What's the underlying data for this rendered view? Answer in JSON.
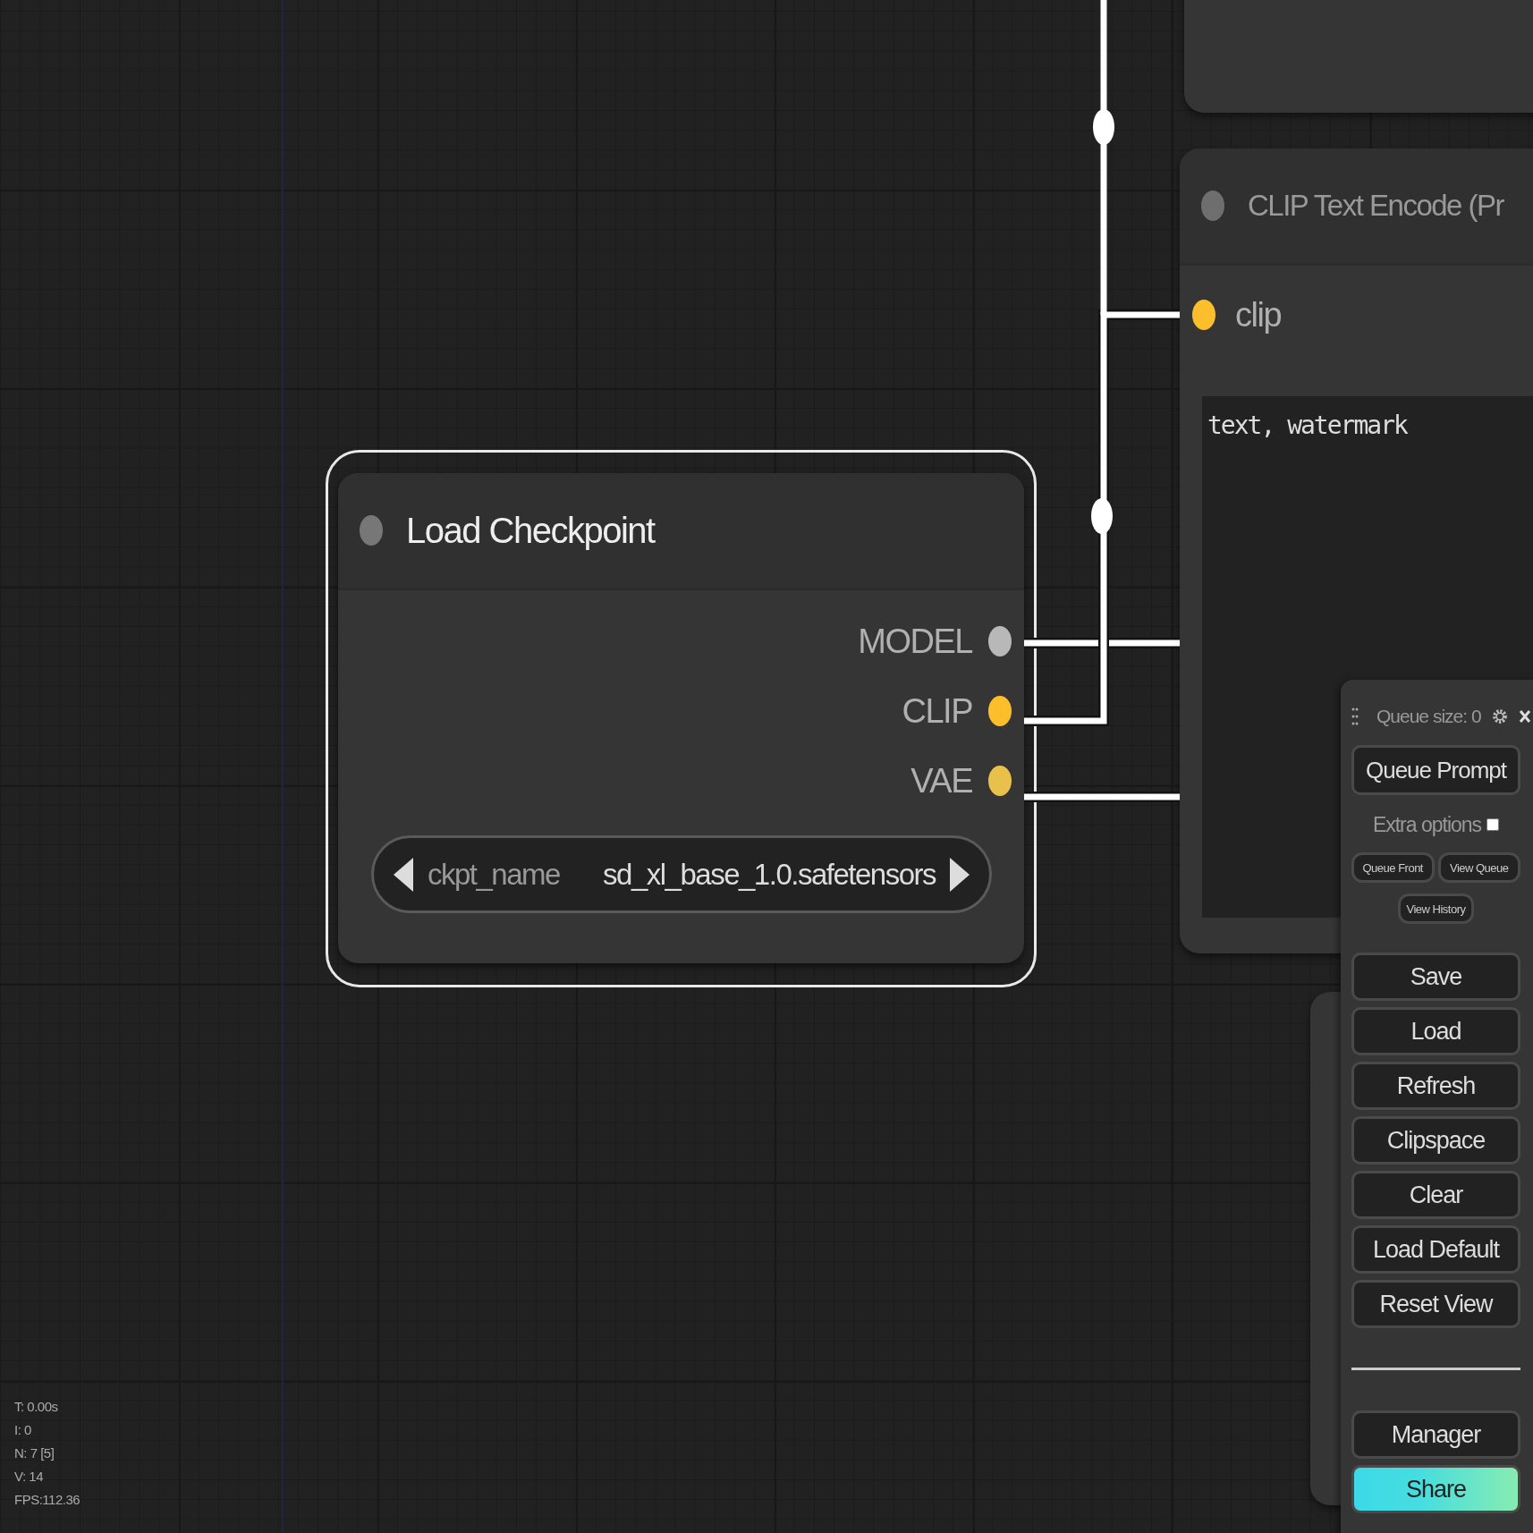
{
  "load_checkpoint": {
    "title": "Load Checkpoint",
    "selected": true,
    "outputs": [
      {
        "label": "MODEL",
        "color": "#b8b8b8"
      },
      {
        "label": "CLIP",
        "color": "#fcbf2b"
      },
      {
        "label": "VAE",
        "color": "#e8c04a"
      }
    ],
    "widget": {
      "name": "ckpt_name",
      "value": "sd_xl_base_1.0.safetensors"
    }
  },
  "clip_text_encode": {
    "title": "CLIP Text Encode (Pr",
    "inputs": [
      {
        "label": "clip",
        "color": "#fcbf2b"
      }
    ],
    "text": "text, watermark"
  },
  "menu": {
    "queue_size": "Queue size: 0",
    "queue_button": "Queue Prompt",
    "extra_options": {
      "label": "Extra options",
      "checked": false
    },
    "small_buttons": [
      "Queue Front",
      "View Queue",
      "View History"
    ],
    "buttons": [
      "Save",
      "Load",
      "Refresh",
      "Clipspace",
      "Clear",
      "Load Default",
      "Reset View"
    ],
    "extension_buttons": [
      {
        "label": "Manager",
        "kind": "plain"
      },
      {
        "label": "Share",
        "kind": "gradient"
      }
    ]
  },
  "stats": [
    "T: 0.00s",
    "I: 0",
    "N: 7 [5]",
    "V: 14",
    "FPS:112.36"
  ]
}
